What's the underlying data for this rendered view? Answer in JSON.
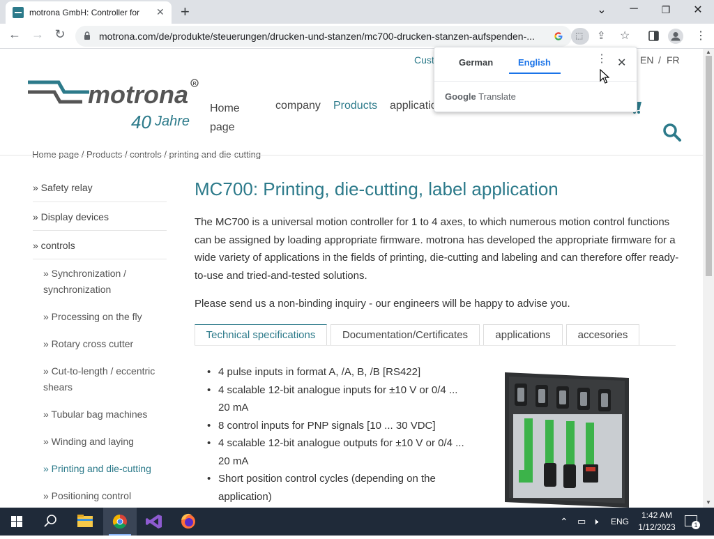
{
  "browser": {
    "tab_title": "motrona GmbH: Controller for pr",
    "url": "motrona.com/de/produkte/steuerungen/drucken-und-stanzen/mc700-drucken-stanzen-aufspenden-..."
  },
  "header": {
    "customer_link": "Cust",
    "lang_en": "EN",
    "lang_sep": "/",
    "lang_fr": "FR",
    "logo_text": "motrona",
    "logo_trademark": "R",
    "logo_anniversary_number": "40",
    "logo_anniversary_word": "Jahre",
    "nav": {
      "home_line1": "Home",
      "home_line2": "page",
      "company": "company",
      "products": "Products",
      "applications": "applicatio"
    }
  },
  "breadcrumb": "Home page  /  Products  /  controls  /  printing and die-cutting",
  "sidebar": {
    "items": [
      {
        "label": "» Safety relay"
      },
      {
        "label": "» Display devices"
      },
      {
        "label": "» controls"
      }
    ],
    "subitems": [
      {
        "label": "» Synchronization / synchronization"
      },
      {
        "label": "» Processing on the fly"
      },
      {
        "label": "» Rotary cross cutter"
      },
      {
        "label": "» Cut-to-length / eccentric shears"
      },
      {
        "label": "» Tubular bag machines"
      },
      {
        "label": "» Winding and laying"
      },
      {
        "label": "» Printing and die-cutting"
      },
      {
        "label": "» Positioning control"
      }
    ]
  },
  "main": {
    "title": "MC700: Printing, die-cutting, label application",
    "intro": "The MC700 is a universal motion controller for 1 to 4 axes, to which numerous motion control functions can be assigned by loading appropriate firmware. motrona has developed the appropriate firmware for a wide variety of applications in the fields of printing, die-cutting and labeling and can therefore offer ready-to-use and tried-and-tested solutions.",
    "inquiry": "Please send us a non-binding inquiry - our engineers will be happy to advise you.",
    "tabs": [
      {
        "label": "Technical specifications"
      },
      {
        "label": "Documentation/Certificates"
      },
      {
        "label": "applications"
      },
      {
        "label": "accesories"
      }
    ],
    "specs": [
      "4 pulse inputs in format A, /A, B, /B [RS422]",
      "4 scalable 12-bit analogue inputs for ±10 V or 0/4 ... 20 mA",
      "8 control inputs for PNP signals [10 ... 30 VDC]",
      "4 scalable 12-bit analogue outputs for ±10 V or 0/4 ... 20 mA",
      "Short position control cycles (depending on the application)"
    ]
  },
  "translate_popup": {
    "lang_from": "German",
    "lang_to": "English",
    "brand_google": "Google",
    "brand_translate": "Translate"
  },
  "taskbar": {
    "lang": "ENG",
    "time": "1:42 AM",
    "date": "1/12/2023",
    "notification_count": "1"
  },
  "colors": {
    "brand_teal": "#2c7a8a",
    "chrome_tab_bg": "#dee1e6",
    "translate_accent": "#1a73e8",
    "taskbar_bg": "#1f2a39"
  }
}
